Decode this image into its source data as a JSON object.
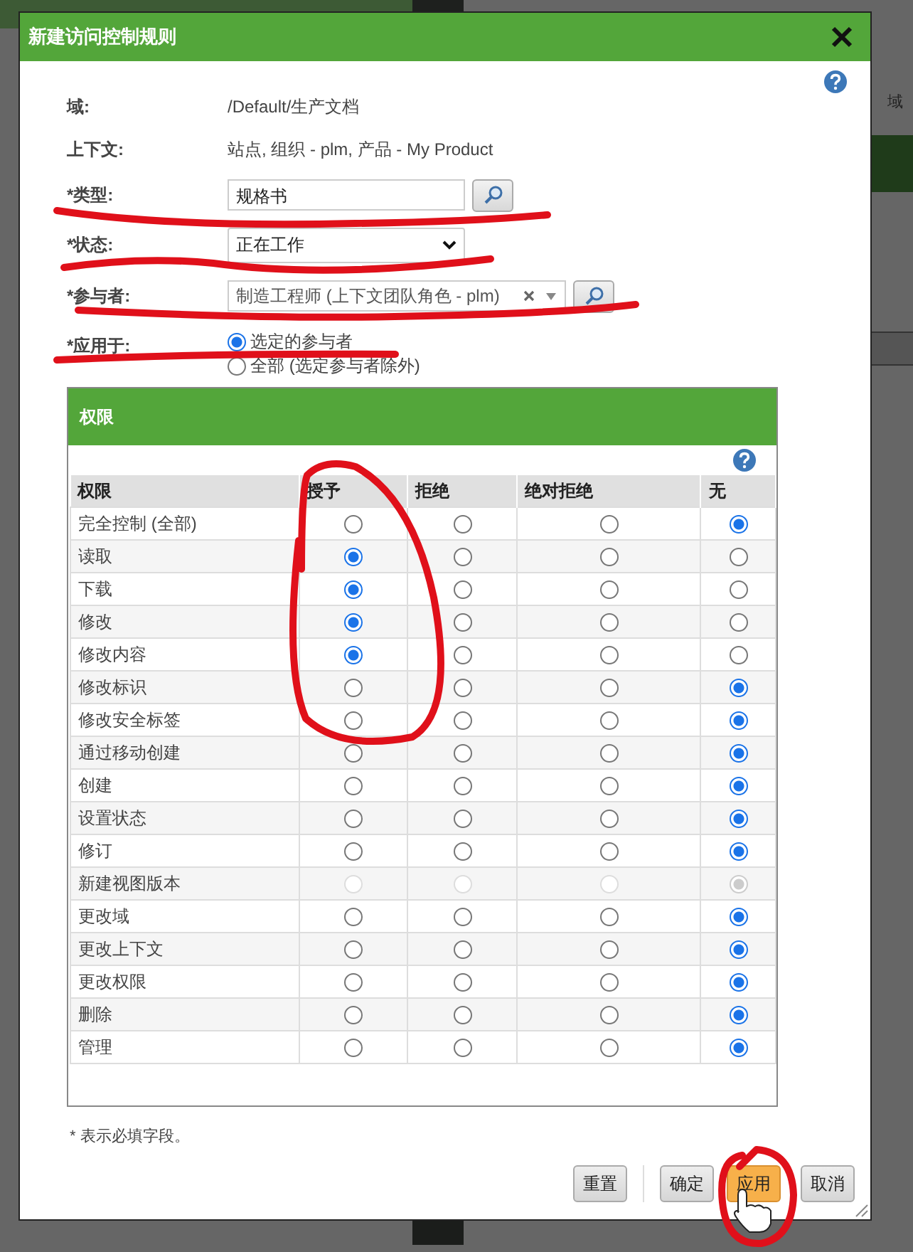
{
  "background": {
    "side_text": "域"
  },
  "dialog": {
    "title": "新建访问控制规则"
  },
  "fields": [
    {
      "kind": "text",
      "label": "域:",
      "value": "/Default/生产文档"
    },
    {
      "kind": "text",
      "label": "上下文:",
      "value": "站点, 组织 - plm, 产品 - My Product"
    },
    {
      "kind": "lookup",
      "label": "*类型:",
      "value": "规格书"
    },
    {
      "kind": "select",
      "label": "*状态:",
      "value": "正在工作"
    },
    {
      "kind": "multi",
      "label": "*参与者:",
      "value": "制造工程师 (上下文团队角色 - plm)"
    },
    {
      "kind": "radios",
      "label": "*应用于:",
      "options": [
        {
          "label": "选定的参与者",
          "selected": true
        },
        {
          "label": "全部 (选定参与者除外)",
          "selected": false
        }
      ]
    }
  ],
  "permissions": {
    "title": "权限",
    "columns": [
      "权限",
      "授予",
      "拒绝",
      "绝对拒绝",
      "无"
    ],
    "rows": [
      {
        "label": "完全控制 (全部)",
        "disabled": false,
        "options": [
          {
            "selected": false
          },
          {
            "selected": false
          },
          {
            "selected": false
          },
          {
            "selected": true
          }
        ]
      },
      {
        "label": "读取",
        "disabled": false,
        "options": [
          {
            "selected": true
          },
          {
            "selected": false
          },
          {
            "selected": false
          },
          {
            "selected": false
          }
        ]
      },
      {
        "label": "下载",
        "disabled": false,
        "options": [
          {
            "selected": true
          },
          {
            "selected": false
          },
          {
            "selected": false
          },
          {
            "selected": false
          }
        ]
      },
      {
        "label": "修改",
        "disabled": false,
        "options": [
          {
            "selected": true
          },
          {
            "selected": false
          },
          {
            "selected": false
          },
          {
            "selected": false
          }
        ]
      },
      {
        "label": "修改内容",
        "disabled": false,
        "options": [
          {
            "selected": true
          },
          {
            "selected": false
          },
          {
            "selected": false
          },
          {
            "selected": false
          }
        ]
      },
      {
        "label": "修改标识",
        "disabled": false,
        "options": [
          {
            "selected": false
          },
          {
            "selected": false
          },
          {
            "selected": false
          },
          {
            "selected": true
          }
        ]
      },
      {
        "label": "修改安全标签",
        "disabled": false,
        "options": [
          {
            "selected": false
          },
          {
            "selected": false
          },
          {
            "selected": false
          },
          {
            "selected": true
          }
        ]
      },
      {
        "label": "通过移动创建",
        "disabled": false,
        "options": [
          {
            "selected": false
          },
          {
            "selected": false
          },
          {
            "selected": false
          },
          {
            "selected": true
          }
        ]
      },
      {
        "label": "创建",
        "disabled": false,
        "options": [
          {
            "selected": false
          },
          {
            "selected": false
          },
          {
            "selected": false
          },
          {
            "selected": true
          }
        ]
      },
      {
        "label": "设置状态",
        "disabled": false,
        "options": [
          {
            "selected": false
          },
          {
            "selected": false
          },
          {
            "selected": false
          },
          {
            "selected": true
          }
        ]
      },
      {
        "label": "修订",
        "disabled": false,
        "options": [
          {
            "selected": false
          },
          {
            "selected": false
          },
          {
            "selected": false
          },
          {
            "selected": true
          }
        ]
      },
      {
        "label": "新建视图版本",
        "disabled": true,
        "options": [
          {
            "selected": false
          },
          {
            "selected": false
          },
          {
            "selected": false
          },
          {
            "selected": true
          }
        ]
      },
      {
        "label": "更改域",
        "disabled": false,
        "options": [
          {
            "selected": false
          },
          {
            "selected": false
          },
          {
            "selected": false
          },
          {
            "selected": true
          }
        ]
      },
      {
        "label": "更改上下文",
        "disabled": false,
        "options": [
          {
            "selected": false
          },
          {
            "selected": false
          },
          {
            "selected": false
          },
          {
            "selected": true
          }
        ]
      },
      {
        "label": "更改权限",
        "disabled": false,
        "options": [
          {
            "selected": false
          },
          {
            "selected": false
          },
          {
            "selected": false
          },
          {
            "selected": true
          }
        ]
      },
      {
        "label": "删除",
        "disabled": false,
        "options": [
          {
            "selected": false
          },
          {
            "selected": false
          },
          {
            "selected": false
          },
          {
            "selected": true
          }
        ]
      },
      {
        "label": "管理",
        "disabled": false,
        "options": [
          {
            "selected": false
          },
          {
            "selected": false
          },
          {
            "selected": false
          },
          {
            "selected": true
          }
        ]
      }
    ]
  },
  "footnote": "* 表示必填字段。",
  "buttons": [
    {
      "label": "重置",
      "hovered": false
    },
    {
      "label": "确定",
      "hovered": false
    },
    {
      "label": "应用",
      "hovered": true
    },
    {
      "label": "取消",
      "hovered": false
    }
  ]
}
